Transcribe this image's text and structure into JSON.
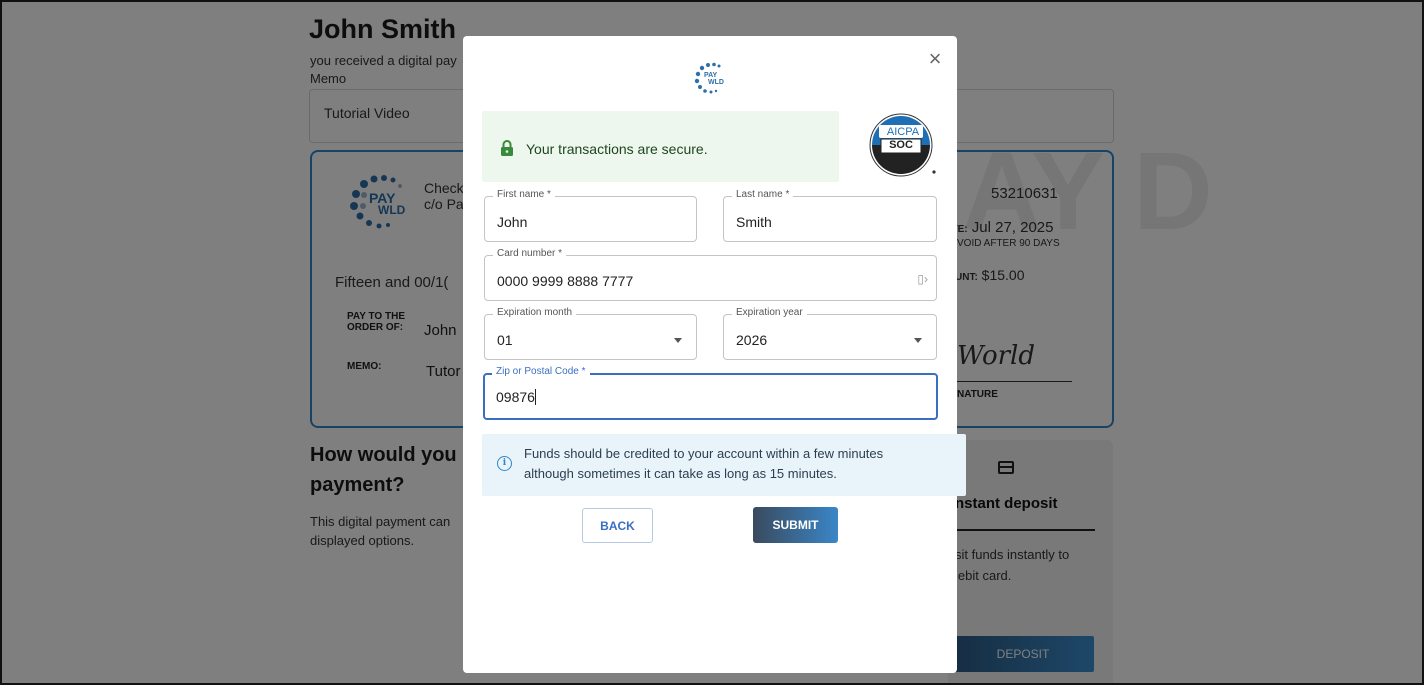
{
  "background": {
    "recipient_name": "John Smith",
    "received_text": "you received a digital pay",
    "memo_label": "Memo",
    "memo_value": "Tutorial Video",
    "check": {
      "logo_text_1": "PAY",
      "logo_text_2": "WLD",
      "issuer_line_1": "Check",
      "issuer_line_2": "c/o Pa",
      "check_number": "53210631",
      "date_label": "ATE:",
      "date_value": "Jul 27, 2025",
      "void_text": "VOID AFTER 90 DAYS",
      "amount_label": "UNT:",
      "amount_value": "$15.00",
      "amount_words": "Fifteen and 00/1(",
      "pay_to_label": "PAY TO THE ORDER OF:",
      "pay_to_value": "John",
      "memo_label": "MEMO:",
      "memo_value": "Tutor",
      "signature": "World",
      "signature_label": "NATURE",
      "watermark": "AY D"
    },
    "question_title": "How would you l payment?",
    "question_text": "This digital payment can displayed options.",
    "deposit": {
      "title": "nstant deposit",
      "desc_line_1": "sit funds instantly to",
      "desc_line_2": "lebit card.",
      "button": "DEPOSIT"
    }
  },
  "modal": {
    "logo_text_1": "PAY",
    "logo_text_2": "WLD",
    "secure_text": "Your transactions are secure.",
    "badge": {
      "top": "AICPA",
      "middle": "SOC"
    },
    "fields": {
      "first_name": {
        "label": "First name *",
        "value": "John"
      },
      "last_name": {
        "label": "Last name *",
        "value": "Smith"
      },
      "card_number": {
        "label": "Card number *",
        "value": "0000 9999 8888 7777"
      },
      "exp_month": {
        "label": "Expiration month",
        "value": "01"
      },
      "exp_year": {
        "label": "Expiration year",
        "value": "2026"
      },
      "zip": {
        "label": "Zip or Postal Code *",
        "value": "09876"
      }
    },
    "info_line_1": "Funds should be credited to your account within a few minutes",
    "info_line_2": "although sometimes it can take as long as 15 minutes.",
    "back_button": "BACK",
    "submit_button": "SUBMIT"
  },
  "colors": {
    "accent_blue": "#3a6fbf",
    "secure_bg": "#edf7ed",
    "secure_icon": "#3a8a3e",
    "info_bg": "#e8f4fa",
    "check_border": "#2f86c8"
  },
  "icons": [
    "close-icon",
    "lock-icon",
    "info-icon",
    "card-icon",
    "chevron-down-icon"
  ]
}
